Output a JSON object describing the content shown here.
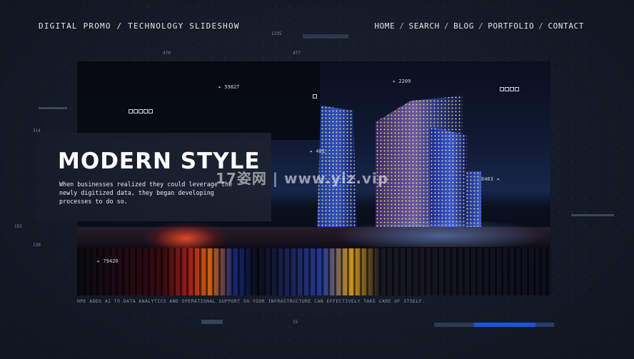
{
  "header": {
    "title": "DIGITAL PROMO / TECHNOLOGY SLIDESHOW",
    "nav": [
      {
        "label": "HOME"
      },
      {
        "label": "SEARCH"
      },
      {
        "label": "BLOG"
      },
      {
        "label": "PORTFOLIO"
      },
      {
        "label": "CONTACT"
      }
    ],
    "nav_separator": "/"
  },
  "hero": {
    "headline": "MODERN STYLE",
    "description": "When businesses realized they could leverage the newly digitized data, they began developing processes to do so."
  },
  "watermark": "17姿网 | www.yiz.vip",
  "hud_labels": {
    "n59827": "▸ 59827",
    "n2209": "▸ 2209",
    "n6463": "6463 ◂",
    "n481": "▸ 481",
    "n79420": "▸ 79420",
    "n470": "470",
    "n477": "477",
    "n1235": "1235",
    "n314": "314",
    "n152": "152",
    "n130": "130",
    "n15": "15"
  },
  "tagline": "HPE ADDS AI TO DATA ANALYTICS AND OPERATIONAL SUPPORT SO YOUR INFRASTRUCTURE CAN EFFECTIVELY TAKE CARE OF ITSELF.",
  "colors": {
    "background": "#1b2230",
    "accent_blue": "#1a56d6",
    "text_primary": "#ffffff",
    "hud_text": "#7f8aa0"
  }
}
